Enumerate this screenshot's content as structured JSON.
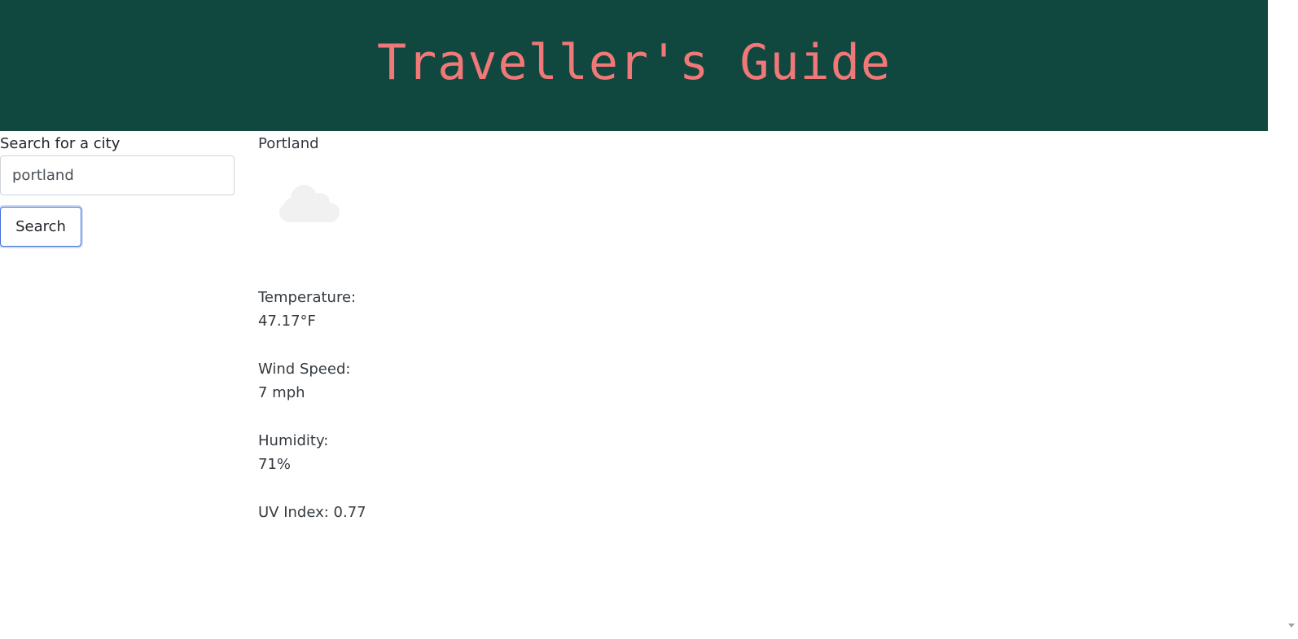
{
  "header": {
    "title": "Traveller's Guide"
  },
  "search": {
    "label": "Search for a city",
    "value": "portland",
    "button_label": "Search"
  },
  "weather": {
    "city": "Portland",
    "icon": "cloud-icon",
    "temperature_label": "Temperature:",
    "temperature_value": "47.17°F",
    "wind_label": "Wind Speed:",
    "wind_value": "7 mph",
    "humidity_label": "Humidity:",
    "humidity_value": "71%",
    "uv_text": "UV Index: 0.77"
  },
  "colors": {
    "header_bg": "#10473e",
    "header_title": "#f07878",
    "button_border": "#3f6fd9"
  }
}
